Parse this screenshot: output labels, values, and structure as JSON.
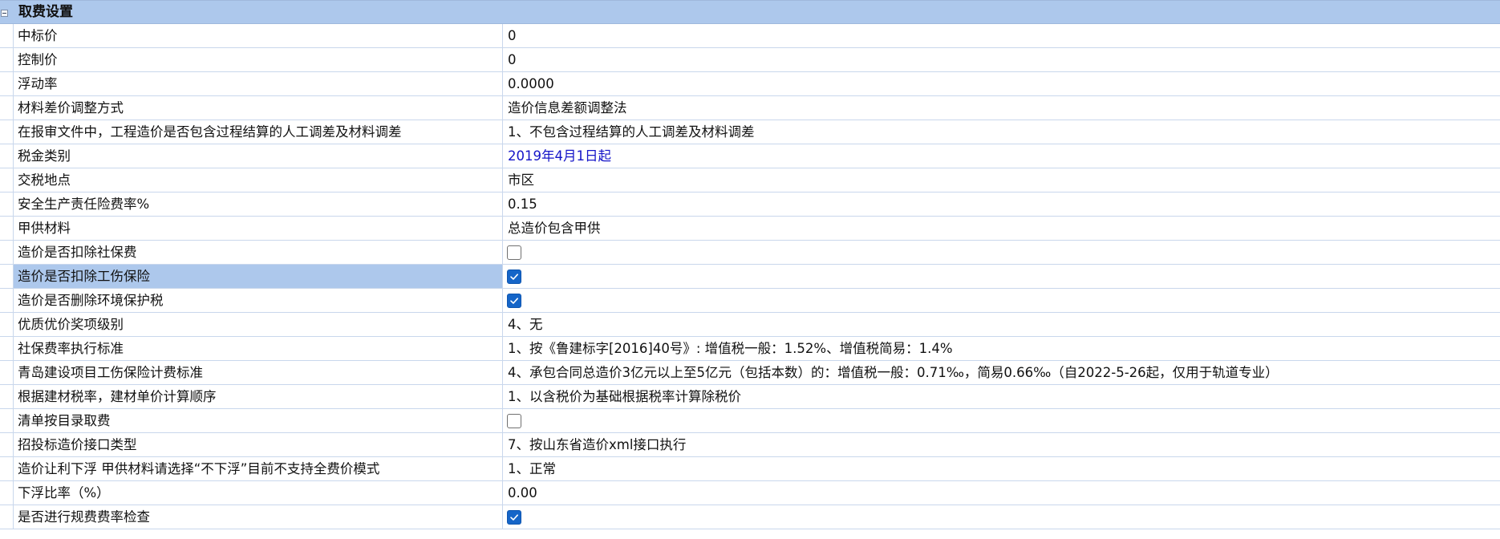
{
  "section": {
    "title": "取费设置",
    "collapse_icon": "minus-box-icon"
  },
  "rows": [
    {
      "label": "中标价",
      "type": "text",
      "value": "0"
    },
    {
      "label": "控制价",
      "type": "text",
      "value": "0"
    },
    {
      "label": "浮动率",
      "type": "text",
      "value": "0.0000"
    },
    {
      "label": "材料差价调整方式",
      "type": "text",
      "value": "造价信息差额调整法"
    },
    {
      "label": "在报审文件中，工程造价是否包含过程结算的人工调差及材料调差",
      "type": "text",
      "value": "1、不包含过程结算的人工调差及材料调差"
    },
    {
      "label": "税金类别",
      "type": "text",
      "value": "2019年4月1日起",
      "link_color": "#1414c8"
    },
    {
      "label": "交税地点",
      "type": "text",
      "value": "市区"
    },
    {
      "label": "安全生产责任险费率%",
      "type": "text",
      "value": "0.15"
    },
    {
      "label": "甲供材料",
      "type": "text",
      "value": "总造价包含甲供"
    },
    {
      "label": "造价是否扣除社保费",
      "type": "checkbox",
      "checked": false
    },
    {
      "label": "造价是否扣除工伤保险",
      "type": "checkbox",
      "checked": true,
      "selected": true
    },
    {
      "label": "造价是否删除环境保护税",
      "type": "checkbox",
      "checked": true
    },
    {
      "label": "优质优价奖项级别",
      "type": "text",
      "value": "4、无"
    },
    {
      "label": "社保费率执行标准",
      "type": "text",
      "value": "1、按《鲁建标字[2016]40号》: 增值税一般：1.52%、增值税简易：1.4%"
    },
    {
      "label": "青岛建设项目工伤保险计费标准",
      "type": "text",
      "value": "4、承包合同总造价3亿元以上至5亿元（包括本数）的：增值税一般：0.71‰，简易0.66‰（自2022-5-26起，仅用于轨道专业）"
    },
    {
      "label": "根据建材税率，建材单价计算顺序",
      "type": "text",
      "value": "1、以含税价为基础根据税率计算除税价"
    },
    {
      "label": "清单按目录取费",
      "type": "checkbox",
      "checked": false
    },
    {
      "label": "招投标造价接口类型",
      "type": "text",
      "value": "7、按山东省造价xml接口执行"
    },
    {
      "label": "造价让利下浮   甲供材料请选择“不下浮”目前不支持全费价模式",
      "type": "text",
      "value": "1、正常"
    },
    {
      "label": "下浮比率（%）",
      "type": "text",
      "value": "0.00"
    },
    {
      "label": "是否进行规费费率检查",
      "type": "checkbox",
      "checked": true
    }
  ],
  "colors": {
    "header_bg": "#adc8ec",
    "selected_bg": "#adc8ec",
    "grid_line": "#c9d7ec",
    "checkbox_checked": "#1565c8",
    "link_text": "#1414c8"
  }
}
